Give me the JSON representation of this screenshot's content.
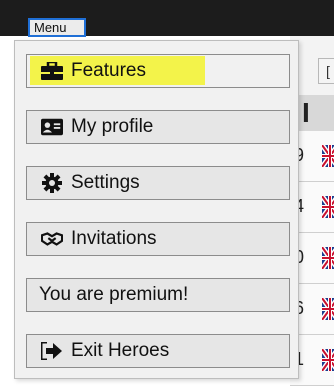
{
  "topbar": {
    "menu_label": "Menu"
  },
  "menu": {
    "items": [
      {
        "label": "Features",
        "icon": "briefcase-icon",
        "highlighted": true
      },
      {
        "label": "My profile",
        "icon": "id-card-icon"
      },
      {
        "label": "Settings",
        "icon": "gear-icon"
      },
      {
        "label": "Invitations",
        "icon": "handshake-icon"
      },
      {
        "label": "You are premium!",
        "icon": ""
      },
      {
        "label": "Exit Heroes",
        "icon": "sign-out-icon"
      }
    ]
  },
  "background": {
    "rows": [
      {
        "value": "9"
      },
      {
        "value": "4"
      },
      {
        "value": "0"
      },
      {
        "value": "6"
      },
      {
        "value": "1"
      }
    ]
  },
  "colors": {
    "highlight": "#f3f34a",
    "menu_border": "#1f6fd6"
  }
}
